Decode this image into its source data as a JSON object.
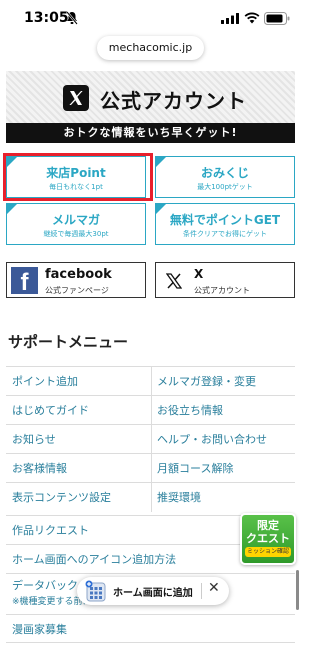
{
  "status_bar": {
    "time": "13:05"
  },
  "browser": {
    "url": "mechacomic.jp"
  },
  "x_banner": {
    "title": "公式アカウント",
    "subtitle": "おトクな情報をいち早くゲット!"
  },
  "promos": [
    {
      "title": "来店Point",
      "sub": "毎日もれなく1pt"
    },
    {
      "title": "おみくじ",
      "sub": "最大100ptゲット"
    },
    {
      "title": "メルマガ",
      "sub": "継続で毎週最大30pt"
    },
    {
      "title": "無料でポイントGET",
      "sub": "条件クリアでお得にゲット"
    }
  ],
  "sns": {
    "facebook": {
      "name": "facebook",
      "sub": "公式ファンページ"
    },
    "x": {
      "name": "X",
      "sub": "公式アカウント"
    }
  },
  "support": {
    "heading": "サポートメニュー",
    "grid": [
      [
        "ポイント追加",
        "メルマガ登録・変更"
      ],
      [
        "はじめてガイド",
        "お役立ち情報"
      ],
      [
        "お知らせ",
        "ヘルプ・お問い合わせ"
      ],
      [
        "お客様情報",
        "月額コース解除"
      ],
      [
        "表示コンテンツ設定",
        "推奨環境"
      ]
    ],
    "list": [
      "作品リクエスト",
      "ホーム画面へのアイコン追加方法"
    ],
    "data_backup": {
      "title": "データバック",
      "sub": "※機種変更する前に必ずご確認ください"
    },
    "last_item": "漫画家募集"
  },
  "quest_badge": {
    "line1": "限定",
    "line2": "クエスト",
    "line3": "ミッション確認"
  },
  "toast": {
    "text": "ホーム画面に追加",
    "close": "✕"
  },
  "colors": {
    "accent": "#2ba7c4",
    "link": "#2a7f9c",
    "highlight": "#e8202c",
    "facebook": "#3b5998",
    "quest": "#3aa832"
  }
}
